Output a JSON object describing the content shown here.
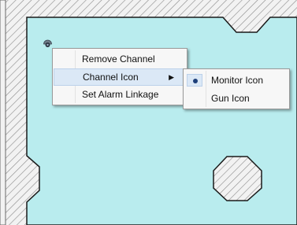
{
  "colors": {
    "floor": "#b9ecee",
    "wall_hatch": "#8a8a8a",
    "wall_outline": "#1a1a1a",
    "menu_bg": "#f7f7f7",
    "menu_highlight": "#dbe8f6"
  },
  "context_menu": {
    "items": [
      {
        "label": "Remove Channel",
        "highlighted": false,
        "has_submenu": false
      },
      {
        "label": "Channel Icon",
        "highlighted": true,
        "has_submenu": true
      },
      {
        "label": "Set Alarm Linkage",
        "highlighted": false,
        "has_submenu": false
      }
    ]
  },
  "channel_icon_submenu": {
    "items": [
      {
        "label": "Monitor Icon",
        "selected": true
      },
      {
        "label": "Gun Icon",
        "selected": false
      }
    ]
  },
  "icons": {
    "channel_marker": "camera-icon",
    "submenu_arrow": "chevron-right-icon",
    "selected_marker": "radio-dot-icon"
  }
}
